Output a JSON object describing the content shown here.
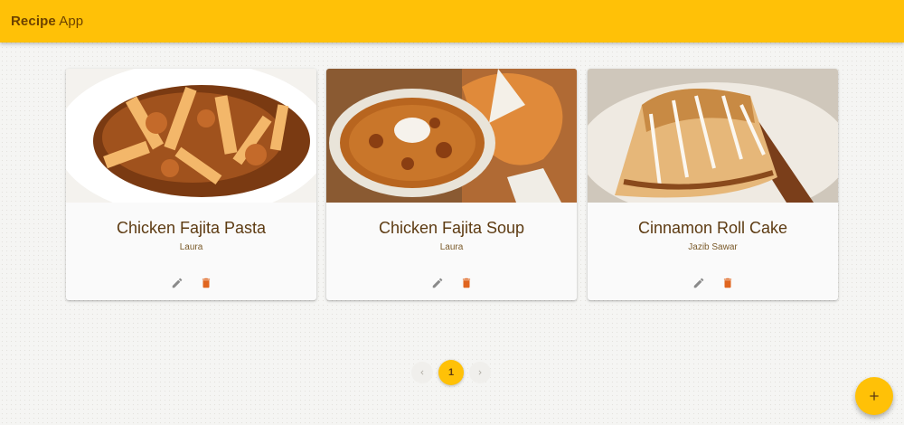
{
  "app": {
    "title_bold": "Recipe",
    "title_rest": " App"
  },
  "recipes": [
    {
      "title": "Chicken Fajita Pasta",
      "author": "Laura",
      "image_icon": "pasta-photo"
    },
    {
      "title": "Chicken Fajita Soup",
      "author": "Laura",
      "image_icon": "soup-photo"
    },
    {
      "title": "Cinnamon Roll Cake",
      "author": "Jazib Sawar",
      "image_icon": "cake-photo"
    }
  ],
  "pagination": {
    "current_page": "1"
  },
  "icons": {
    "edit": "pencil-icon",
    "delete": "trash-icon",
    "prev": "chevron-left-icon",
    "next": "chevron-right-icon",
    "add": "plus-icon"
  },
  "colors": {
    "accent": "#ffc107",
    "text": "#5d3b12",
    "icon_edit": "#8a8a8a",
    "icon_delete": "#e0651f"
  }
}
